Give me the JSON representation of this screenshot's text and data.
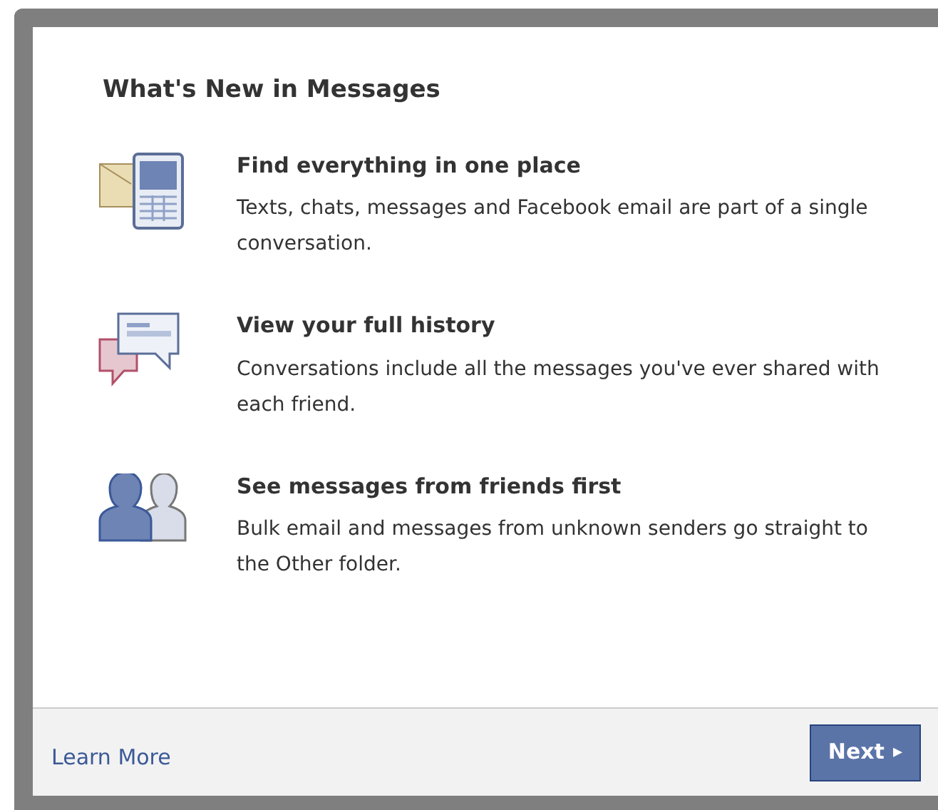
{
  "dialog": {
    "title": "What's New in Messages",
    "features": [
      {
        "kind": "envelope-phone",
        "title": "Find everything in one place",
        "text": "Texts, chats, messages and Facebook email are part of a single conversation."
      },
      {
        "kind": "chat",
        "title": "View your full history",
        "text": "Conversations include all the messages you've ever shared with each friend."
      },
      {
        "kind": "people",
        "title": "See messages from friends first",
        "text": "Bulk email and messages from unknown senders go straight to the Other folder."
      }
    ],
    "footer": {
      "link": "Learn More",
      "button": "Next",
      "button_arrow": "▸"
    }
  }
}
